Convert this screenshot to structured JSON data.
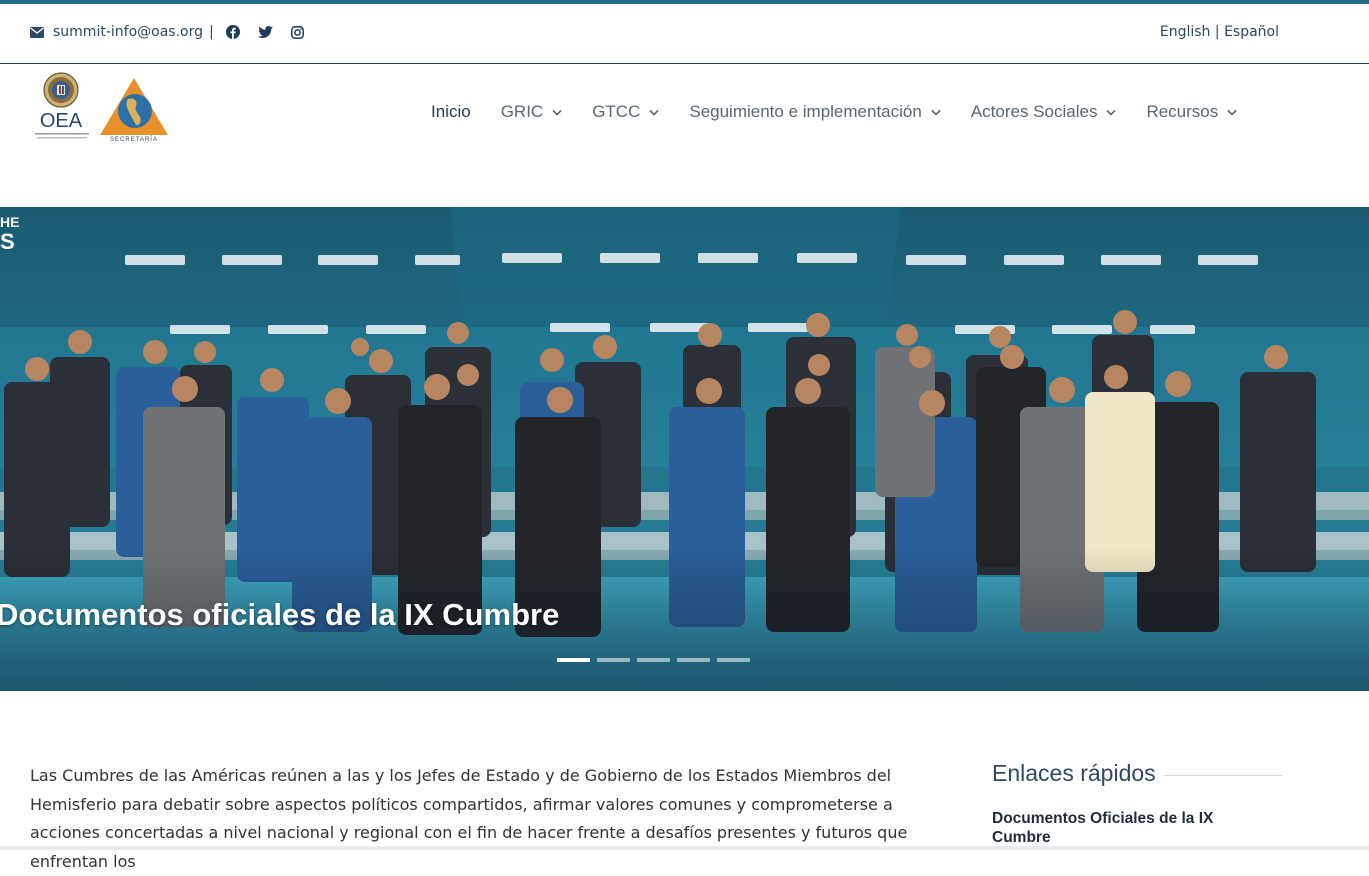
{
  "topbar": {
    "email": "summit-info@oas.org",
    "separator": "|",
    "social_icons": [
      "facebook-icon",
      "twitter-icon",
      "instagram-icon"
    ],
    "lang_english": "English",
    "lang_sep": "|",
    "lang_spanish": "Español"
  },
  "logos": {
    "oea_text": "OEA",
    "cumbres_text": "SECRETARÍA"
  },
  "nav": {
    "items": [
      {
        "label": "Inicio",
        "active": true,
        "dropdown": false
      },
      {
        "label": "GRIC",
        "active": false,
        "dropdown": true
      },
      {
        "label": "GTCC",
        "active": false,
        "dropdown": true
      },
      {
        "label": "Seguimiento e implementación",
        "active": false,
        "dropdown": true
      },
      {
        "label": "Actores Sociales",
        "active": false,
        "dropdown": true
      },
      {
        "label": "Recursos",
        "active": false,
        "dropdown": true
      }
    ]
  },
  "hero": {
    "title": "Documentos oficiales de la IX Cumbre",
    "slides_total": 5,
    "active_slide": 1
  },
  "content": {
    "intro": "Las Cumbres de las Américas reúnen a las y los Jefes de Estado y de Gobierno de los Estados Miembros del Hemisferio para debatir sobre aspectos políticos compartidos, afirmar valores comunes y comprometerse a acciones concertadas a nivel nacional y regional con el fin de hacer frente a desafíos presentes y futuros que enfrentan los"
  },
  "quick_links": {
    "title": "Enlaces rápidos",
    "items": [
      "Documentos Oficiales de la IX Cumbre"
    ]
  },
  "colors": {
    "accent": "#1f6f86",
    "navy": "#2d4963",
    "hero_bg": "#1e5f74"
  }
}
